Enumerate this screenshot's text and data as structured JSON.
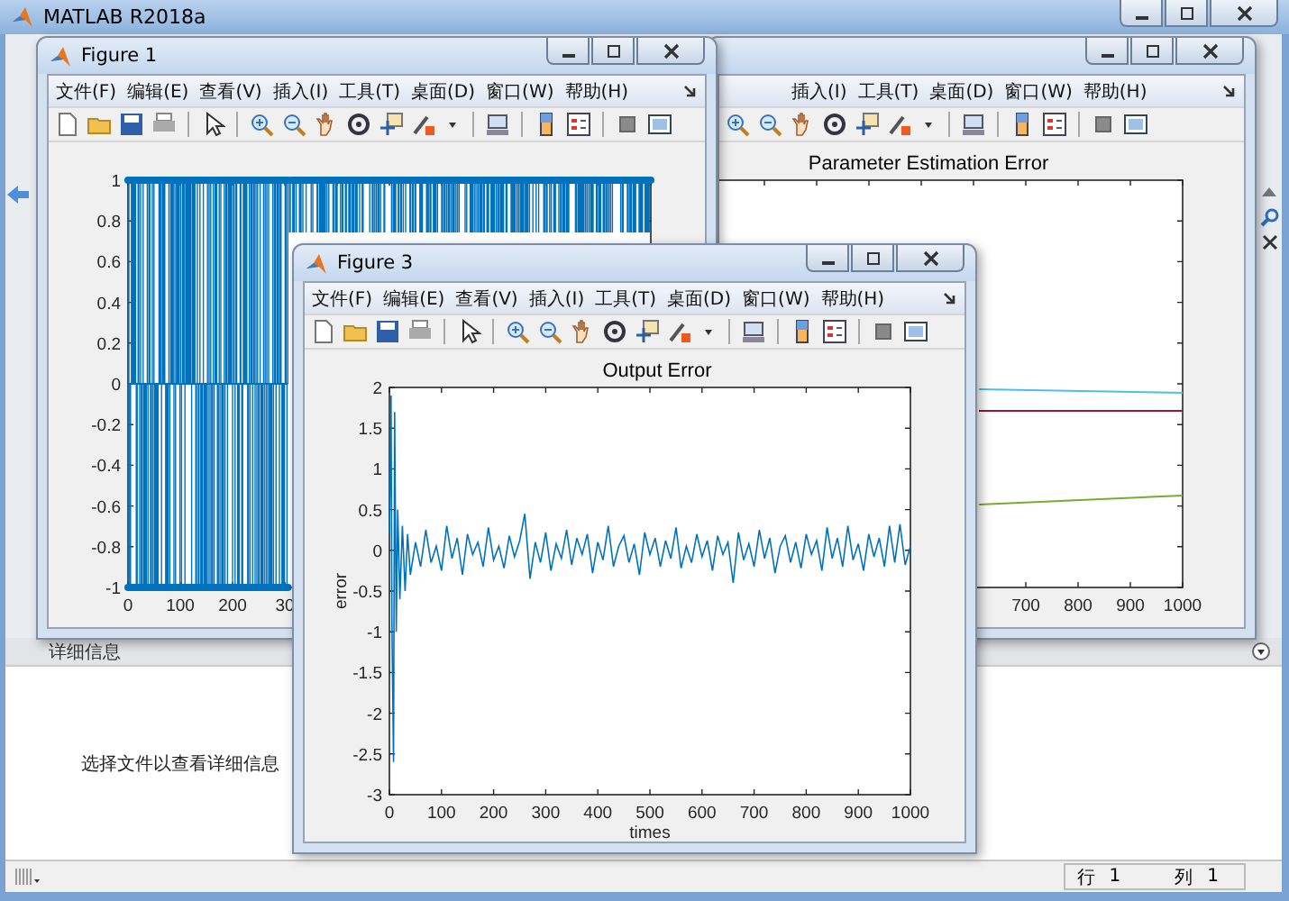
{
  "window": {
    "title": "MATLAB R2018a"
  },
  "details": {
    "header": "详细信息",
    "message": "选择文件以查看详细信息"
  },
  "status_bar": {
    "line_label": "行",
    "line": "1",
    "column_label": "列",
    "column": "1"
  },
  "figures": [
    {
      "title": "Figure 1",
      "menus": [
        "文件(F)",
        "编辑(E)",
        "查看(V)",
        "插入(I)",
        "工具(T)",
        "桌面(D)",
        "窗口(W)",
        "帮助(H)"
      ],
      "plot": {
        "kind": "stem",
        "yticks": [
          "1",
          "0.8",
          "0.6",
          "0.4",
          "0.2",
          "0",
          "-0.2",
          "-0.4",
          "-0.6",
          "-0.8",
          "-1"
        ],
        "xticks": [
          "0",
          "100",
          "200",
          "30"
        ]
      }
    },
    {
      "menus": [
        "插入(I)",
        "工具(T)",
        "桌面(D)",
        "窗口(W)",
        "帮助(H)"
      ],
      "plot": {
        "kind": "lines",
        "title": "Parameter Estimation Error",
        "xticks": [
          "700",
          "800",
          "900",
          "1000"
        ]
      }
    },
    {
      "title": "Figure 3",
      "menus": [
        "文件(F)",
        "编辑(E)",
        "查看(V)",
        "插入(I)",
        "工具(T)",
        "桌面(D)",
        "窗口(W)",
        "帮助(H)"
      ],
      "plot": {
        "kind": "noise",
        "chart_data": {
          "type": "line",
          "title": "Output Error",
          "xlabel": "times",
          "ylabel": "error",
          "xlim": [
            0,
            1000
          ],
          "ylim": [
            -3,
            2
          ],
          "xticks": [
            0,
            100,
            200,
            300,
            400,
            500,
            600,
            700,
            800,
            900,
            1000
          ],
          "yticks": [
            2,
            1.5,
            1,
            0.5,
            0,
            -0.5,
            -1,
            -1.5,
            -2,
            -2.5,
            -3
          ],
          "x": [
            0,
            3,
            5,
            8,
            10,
            13,
            16,
            20,
            25,
            30,
            35,
            40,
            50,
            60,
            70,
            80,
            90,
            100,
            110,
            120,
            130,
            140,
            150,
            160,
            170,
            180,
            190,
            200,
            210,
            220,
            230,
            240,
            250,
            260,
            270,
            280,
            290,
            300,
            310,
            320,
            330,
            340,
            350,
            360,
            370,
            380,
            390,
            400,
            410,
            420,
            430,
            440,
            450,
            460,
            470,
            480,
            490,
            500,
            510,
            520,
            530,
            540,
            550,
            560,
            570,
            580,
            590,
            600,
            610,
            620,
            630,
            640,
            650,
            660,
            670,
            680,
            690,
            700,
            710,
            720,
            730,
            740,
            750,
            760,
            770,
            780,
            790,
            800,
            810,
            820,
            830,
            840,
            850,
            860,
            870,
            880,
            890,
            900,
            910,
            920,
            930,
            940,
            950,
            960,
            970,
            980,
            990,
            1000
          ],
          "series": [
            {
              "color": "#0072bd",
              "values": [
                0.2,
                1.9,
                -0.9,
                -2.6,
                1.7,
                -1.0,
                0.5,
                -0.6,
                0.3,
                -0.5,
                0.2,
                -0.3,
                0.1,
                -0.2,
                0.25,
                -0.15,
                0.05,
                -0.25,
                0.3,
                -0.1,
                0.15,
                -0.3,
                0.2,
                -0.05,
                0.1,
                -0.2,
                0.28,
                -0.12,
                0.05,
                -0.22,
                0.18,
                -0.08,
                0.12,
                0.45,
                -0.35,
                0.1,
                -0.15,
                0.22,
                -0.25,
                0.08,
                -0.1,
                0.25,
                -0.18,
                0.15,
                -0.05,
                0.2,
                -0.28,
                0.1,
                -0.12,
                0.3,
                -0.2,
                0.05,
                0.18,
                -0.15,
                0.08,
                -0.3,
                0.22,
                -0.05,
                0.15,
                -0.2,
                0.12,
                -0.1,
                0.28,
                -0.22,
                0.05,
                -0.15,
                0.2,
                -0.08,
                0.12,
                -0.25,
                0.18,
                -0.05,
                0.1,
                -0.4,
                0.22,
                -0.12,
                0.08,
                -0.2,
                0.25,
                -0.1,
                0.15,
                -0.28,
                0.05,
                0.18,
                -0.15,
                0.1,
                -0.22,
                0.2,
                -0.05,
                0.12,
                -0.25,
                0.28,
                -0.1,
                0.15,
                -0.2,
                0.3,
                -0.12,
                0.08,
                -0.25,
                0.2,
                -0.08,
                0.15,
                -0.2,
                0.3,
                -0.15,
                0.32,
                -0.18,
                0.05
              ]
            }
          ]
        }
      }
    }
  ]
}
